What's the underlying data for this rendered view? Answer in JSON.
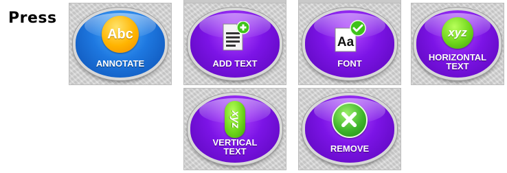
{
  "instruction": {
    "press_label": "Press"
  },
  "buttons": {
    "annotate": {
      "label": "ANNOTATE",
      "icon": "abc-icon",
      "icon_text": "Abc",
      "color": "#1e78e0"
    },
    "add_text": {
      "label": "ADD TEXT",
      "icon": "document-add-icon",
      "color": "#7c14e6"
    },
    "font": {
      "label": "FONT",
      "icon": "font-check-icon",
      "icon_text": "Aa",
      "color": "#7c14e6"
    },
    "horizontal_text": {
      "label": "HORIZONTAL\nTEXT",
      "icon": "xyz-horizontal-icon",
      "icon_text": "xyz",
      "color": "#7c14e6"
    },
    "vertical_text": {
      "label": "VERTICAL\nTEXT",
      "icon": "xyz-vertical-icon",
      "icon_text": "xyz",
      "color": "#7c14e6"
    },
    "remove": {
      "label": "REMOVE",
      "icon": "close-x-icon",
      "color": "#7c14e6"
    }
  }
}
